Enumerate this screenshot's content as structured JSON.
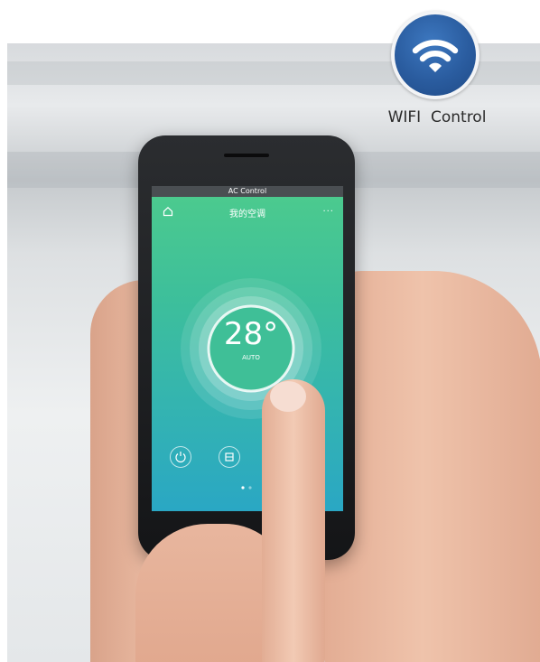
{
  "badge": {
    "label": "WIFI  Control",
    "icon": "wifi-icon",
    "color": "#2a5c9f"
  },
  "phone": {
    "status_bar_text": "AC Control",
    "screen_title": "我的空调",
    "home_icon": "home-icon",
    "more_icon": "more-icon",
    "more_text": "···",
    "temperature": "28°",
    "mode": "AUTO",
    "controls": [
      {
        "icon": "power-icon"
      },
      {
        "icon": "mode-icon"
      },
      {
        "icon": "fan-icon"
      }
    ],
    "screen_gradient": [
      "#4dcb8d",
      "#2aa7c4"
    ]
  }
}
